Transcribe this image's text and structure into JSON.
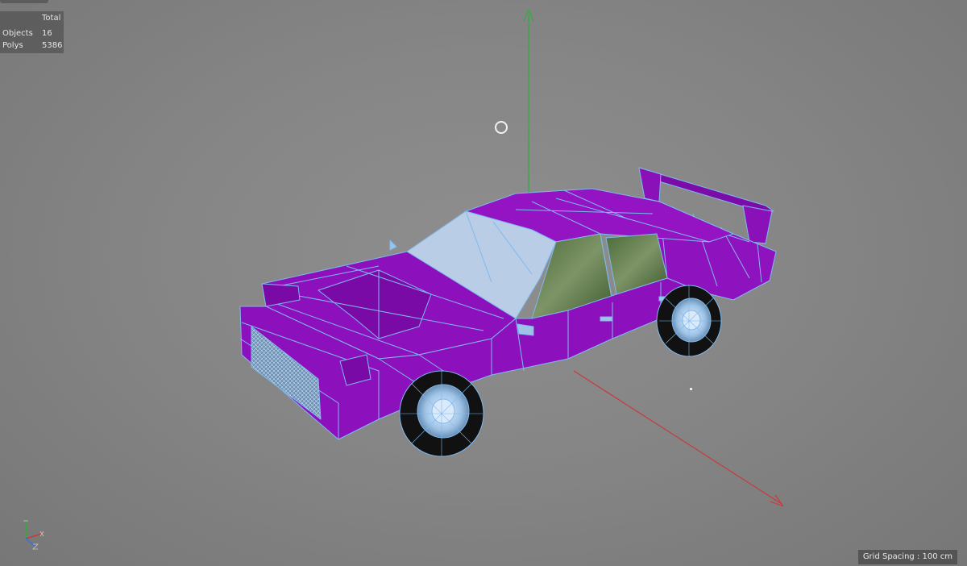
{
  "app": {
    "name": "3D viewport"
  },
  "stats_panel": {
    "header": "Total",
    "rows": [
      {
        "label": "Objects",
        "value": "16"
      },
      {
        "label": "Polys",
        "value": "5386"
      }
    ]
  },
  "footer": {
    "grid_spacing": "Grid Spacing : 100 cm"
  },
  "axes": {
    "y_color": "#2fae3a",
    "x_color": "#c83a3a"
  },
  "model": {
    "body_color": "#8a10b8",
    "wire_color": "#7fb9ee",
    "glass_color": "#b9cde6"
  },
  "icons": {
    "corner_axis": "xyz-axis-icon",
    "viewport_cursor": "circle-cursor-icon"
  }
}
